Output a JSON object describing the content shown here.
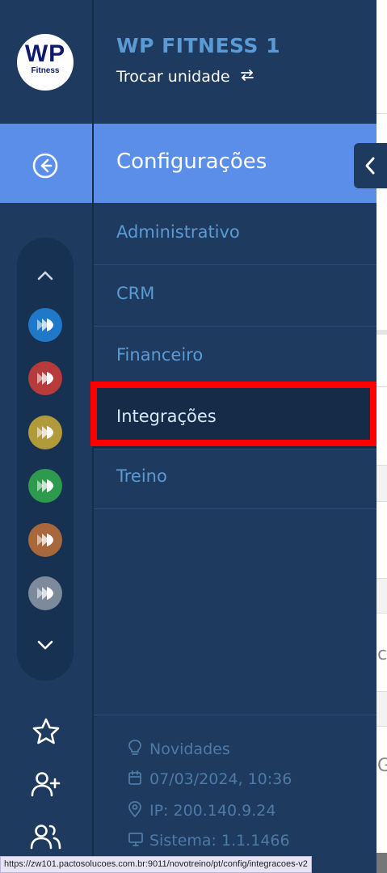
{
  "branding": {
    "logo_main": "WP",
    "logo_sub": "Fitness",
    "unit_name": "WP FITNESS 1",
    "switch_unit_label": "Trocar unidade",
    "switch_icon": "swap-arrows-icon"
  },
  "section": {
    "title": "Configurações",
    "back_icon": "arrow-left-circle-icon",
    "collapse_icon": "chevron-left-icon"
  },
  "menu": {
    "items": [
      {
        "label": "Administrativo"
      },
      {
        "label": "CRM"
      },
      {
        "label": "Financeiro"
      },
      {
        "label": "Integrações",
        "active": true
      },
      {
        "label": "Treino"
      }
    ]
  },
  "modules_rail": {
    "up_icon": "chevron-up-icon",
    "down_icon": "chevron-down-icon",
    "module_colors": [
      "#1f78c8",
      "#b83b3b",
      "#b09a3a",
      "#2e9a4e",
      "#a8683c",
      "#7d8a9c"
    ]
  },
  "rail_bottom": {
    "icons": [
      "star-icon",
      "user-plus-icon",
      "users-icon"
    ]
  },
  "footer": {
    "novidades": "Novidades",
    "datetime": "07/03/2024, 10:36",
    "ip": "IP: 200.140.9.24",
    "sistema": "Sistema: 1.1.1466"
  },
  "right_edge": {
    "text_c": "c",
    "text_g": "G"
  },
  "status_bar": {
    "url": "https://zw101.pactosolucoes.com.br:9011/novotreino/pt/config/integracoes-v2"
  }
}
